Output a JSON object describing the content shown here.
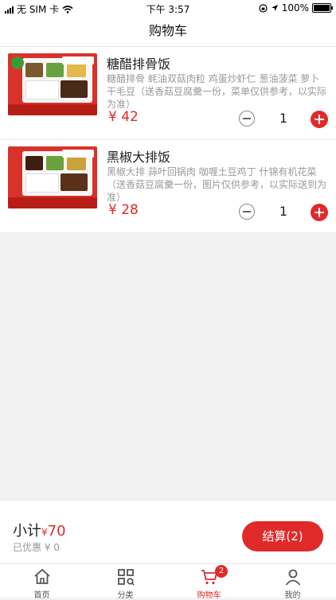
{
  "status": {
    "carrier": "无 SIM 卡",
    "time": "下午 3:57",
    "battery": "100%"
  },
  "header": {
    "title": "购物车"
  },
  "cart": {
    "items": [
      {
        "name": "糖醋排骨饭",
        "description": "糖醋排骨 蚝油双菇肉粒 鸡蛋炒虾仁 葱油菠菜 萝卜干毛豆（送香菇豆腐羹一份，菜单仅供参考，以实际为准）",
        "price": "¥ 42",
        "quantity": "1"
      },
      {
        "name": "黑椒大排饭",
        "description": "黑椒大排 蒜叶回锅肉 咖喱土豆鸡丁 什锦有机花菜（送香菇豆腐羹一份，图片仅供参考，以实际送到为准）",
        "price": "¥ 28",
        "quantity": "1"
      }
    ]
  },
  "summary": {
    "subtotal_label": "小计",
    "subtotal_currency": "¥",
    "subtotal_value": "70",
    "discount_text": "已优惠 ¥ 0",
    "checkout_label": "结算(2)"
  },
  "tabbar": {
    "tabs": [
      {
        "label": "首页",
        "icon": "home-icon"
      },
      {
        "label": "分类",
        "icon": "category-icon"
      },
      {
        "label": "购物车",
        "icon": "cart-icon",
        "badge": "2"
      },
      {
        "label": "我的",
        "icon": "user-icon"
      }
    ]
  },
  "colors": {
    "accent": "#e02a2a"
  }
}
